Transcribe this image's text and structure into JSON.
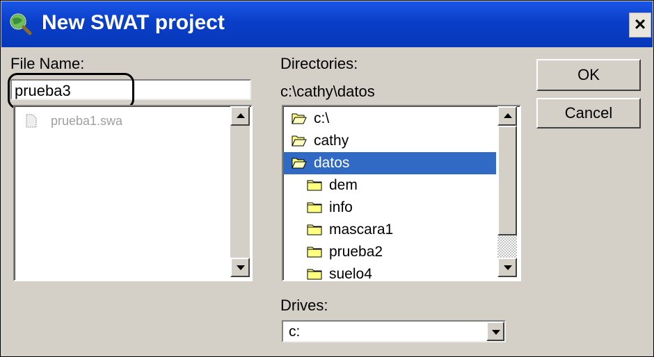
{
  "window": {
    "title": "New SWAT project",
    "close_glyph": "×",
    "title_icon": "globe-magnifier-icon"
  },
  "file_name": {
    "label": "File Name:",
    "value": "prueba3",
    "files": [
      {
        "name": "prueba1.swa",
        "icon": "document-icon"
      }
    ]
  },
  "directories": {
    "label": "Directories:",
    "current_path": "c:\\cathy\\datos",
    "items": [
      {
        "name": "c:\\",
        "icon": "open-folder-icon",
        "selected": false
      },
      {
        "name": "cathy",
        "icon": "open-folder-icon",
        "selected": false
      },
      {
        "name": "datos",
        "icon": "open-folder-icon",
        "selected": true
      },
      {
        "name": "dem",
        "icon": "folder-icon",
        "selected": false
      },
      {
        "name": "info",
        "icon": "folder-icon",
        "selected": false
      },
      {
        "name": "mascara1",
        "icon": "folder-icon",
        "selected": false
      },
      {
        "name": "prueba2",
        "icon": "folder-icon",
        "selected": false
      },
      {
        "name": "suelo4",
        "icon": "folder-icon",
        "selected": false
      }
    ]
  },
  "drives": {
    "label": "Drives:",
    "selected": "c:"
  },
  "buttons": {
    "ok": "OK",
    "cancel": "Cancel"
  },
  "colors": {
    "titlebar": "#0a3ec8",
    "selection": "#316ac5",
    "face": "#d4d0c8",
    "folder": "#ffff80"
  }
}
